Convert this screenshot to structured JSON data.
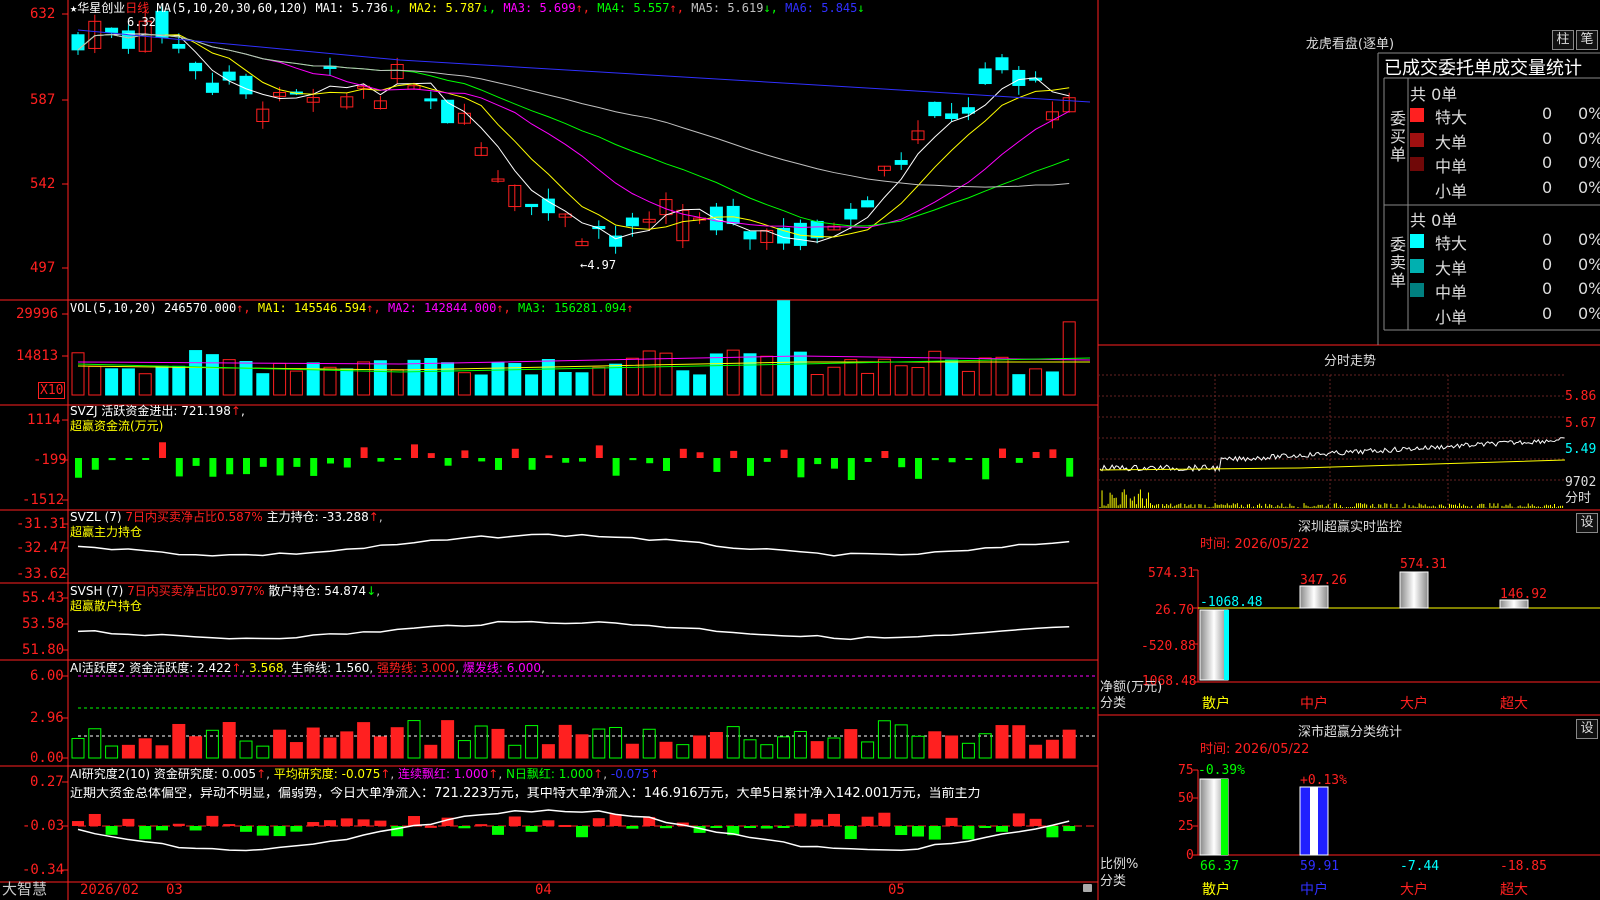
{
  "stock": {
    "star": "★",
    "name": "华星创业",
    "period": "日线",
    "high_mark": "6.32",
    "low_mark": "←4.97"
  },
  "price_panel": {
    "ma_label": "MA(5,10,20,30,60,120)",
    "ma": [
      {
        "label": "MA1: 5.736",
        "arrow": "↓",
        "color": "#ffffff"
      },
      {
        "label": "MA2: 5.787",
        "arrow": "↓",
        "color": "#ffff00"
      },
      {
        "label": "MA3: 5.699",
        "arrow": "↑",
        "color": "#ff00ff"
      },
      {
        "label": "MA4: 5.557",
        "arrow": "↑",
        "color": "#00ff00"
      },
      {
        "label": "MA5: 5.619",
        "arrow": "↓",
        "color": "#c0c0c0"
      },
      {
        "label": "MA6: 5.845",
        "arrow": "↓",
        "color": "#3030ff"
      }
    ],
    "y_ticks": [
      "632",
      "587",
      "542",
      "497"
    ]
  },
  "vol_panel": {
    "label": "VOL(5,10,20)",
    "value": "246570.000",
    "ma": [
      {
        "label": "MA1: 145546.594",
        "color": "#ffff00"
      },
      {
        "label": "MA2: 142844.000",
        "color": "#ff00ff"
      },
      {
        "label": "MA3: 156281.094",
        "color": "#00ff00"
      }
    ],
    "y_ticks": [
      "29996",
      "14813"
    ],
    "unit": "X10"
  },
  "svzj_panel": {
    "label": "SVZJ  活跃资金进出: 721.198",
    "sub": "超赢资金流(万元)",
    "y_ticks": [
      "1114",
      "-199",
      "-1512"
    ]
  },
  "svzl_panel": {
    "label": "SVZL (7)",
    "ratio": "7日内买卖净占比0.587%",
    "hold": "主力持仓: -33.288",
    "sub": "超赢主力持仓",
    "y_ticks": [
      "-31.31",
      "-32.47",
      "-33.62"
    ]
  },
  "svsh_panel": {
    "label": "SVSH (7)",
    "ratio": "7日内买卖净占比0.977%",
    "hold": "散户持仓: 54.874",
    "sub": "超赢散户持仓",
    "y_ticks": [
      "55.43",
      "53.58",
      "51.80"
    ]
  },
  "ai_active_panel": {
    "label": "AI活跃度2",
    "items": [
      {
        "text": "资金活跃度: 2.422",
        "color": "#ffffff"
      },
      {
        "text": "3.568",
        "color": "#ffff00"
      },
      {
        "text": "生命线: 1.560",
        "color": "#ffffff"
      },
      {
        "text": "强势线: 3.000",
        "color": "#ff2020"
      },
      {
        "text": "爆发线: 6.000",
        "color": "#ff00ff"
      }
    ],
    "y_ticks": [
      "6.00",
      "2.96",
      "0.00"
    ]
  },
  "ai_research_panel": {
    "label": "AI研究度2(10)",
    "items": [
      {
        "text": "资金研究度: 0.005",
        "color": "#ffffff"
      },
      {
        "text": "平均研究度: -0.075",
        "color": "#ffff00"
      },
      {
        "text": "连续飘红: 1.000",
        "color": "#ff00ff"
      },
      {
        "text": "N日飘红: 1.000",
        "color": "#00ff00"
      },
      {
        "text": "-0.075",
        "color": "#3030ff"
      }
    ],
    "commentary": "近期大资金总体偏空，异动不明显，偏弱势，今日大单净流入：721.223万元，其中特大单净流入：146.916万元，大单5日累计净入142.001万元，当前主力",
    "y_ticks": [
      "0.27",
      "-0.03",
      "-0.34"
    ]
  },
  "date_axis": {
    "brand": "大智慧",
    "labels": [
      "2026/02",
      "03",
      "04",
      "05"
    ]
  },
  "order_panel": {
    "title": "龙虎看盘(逐单)",
    "btn_bar": "柱",
    "btn_pen": "笔",
    "tabs": "已成交委托单成交量统计",
    "buy": {
      "side": "委买单",
      "total": "共 0单",
      "rows": [
        {
          "name": "特大",
          "count": "0",
          "pct": "0%",
          "color": "#ff2020"
        },
        {
          "name": "大单",
          "count": "0",
          "pct": "0%",
          "color": "#a01010"
        },
        {
          "name": "中单",
          "count": "0",
          "pct": "0%",
          "color": "#700808"
        },
        {
          "name": "小单",
          "count": "0",
          "pct": "0%",
          "color": ""
        }
      ]
    },
    "sell": {
      "side": "委卖单",
      "total": "共 0单",
      "rows": [
        {
          "name": "特大",
          "count": "0",
          "pct": "0%",
          "color": "#00ffff"
        },
        {
          "name": "大单",
          "count": "0",
          "pct": "0%",
          "color": "#00b0b0"
        },
        {
          "name": "中单",
          "count": "0",
          "pct": "0%",
          "color": "#008080"
        },
        {
          "name": "小单",
          "count": "0",
          "pct": "0%",
          "color": ""
        }
      ]
    }
  },
  "intraday": {
    "title": "分时走势",
    "y_ticks": [
      "5.86",
      "5.67",
      "5.49"
    ],
    "vol_tick": "9702",
    "unit": "分时"
  },
  "monitor": {
    "title": "深圳超赢实时监控",
    "btn": "设",
    "time": "时间: 2026/05/22",
    "y_ticks": [
      "574.31",
      "26.70",
      "-520.88",
      "-1068.48"
    ],
    "y_label": "净额(万元)",
    "x_label": "分类",
    "categories": [
      "散户",
      "中户",
      "大户",
      "超大"
    ],
    "values": [
      "-1068.48",
      "347.26",
      "574.31",
      "146.92"
    ]
  },
  "classify": {
    "title": "深市超赢分类统计",
    "btn": "设",
    "time": "时间: 2026/05/22",
    "y_ticks": [
      "75",
      "50",
      "25",
      "0"
    ],
    "y_label": "比例%",
    "x_label": "分类",
    "categories": [
      "散户",
      "中户",
      "大户",
      "超大"
    ],
    "top_values": [
      "-0.39%",
      "+0.13%"
    ],
    "bottom_values": [
      "66.37",
      "59.91",
      "-7.44",
      "-18.85"
    ]
  }
}
